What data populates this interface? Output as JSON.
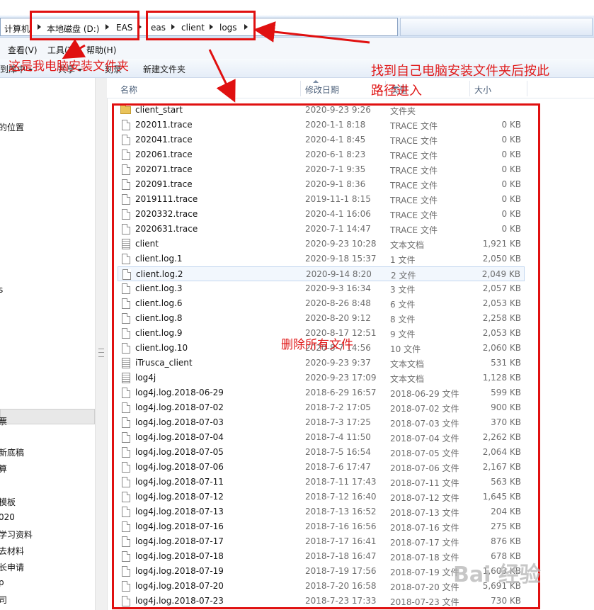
{
  "address": {
    "crumbs": [
      "计算机",
      "本地磁盘 (D:)",
      "EAS",
      "eas",
      "client",
      "logs"
    ]
  },
  "menu": [
    "查看(V)",
    "工具(T)",
    "帮助(H)"
  ],
  "toolbar": {
    "include": "到库中",
    "share": "共享",
    "burn": "刻录",
    "new_folder": "新建文件夹"
  },
  "nav": {
    "items": [
      "的位置",
      "s",
      "票",
      "新底稿",
      "算",
      "模板",
      "020",
      "学习资料",
      "去材料",
      "长申请",
      "p",
      "司"
    ]
  },
  "columns": {
    "name": "名称",
    "date": "修改日期",
    "type": "类型",
    "size": "大小"
  },
  "files": [
    {
      "name": "client_start",
      "date": "2020-9-23 9:26",
      "type": "文件夹",
      "size": "",
      "icon": "folder-icon"
    },
    {
      "name": "202011.trace",
      "date": "2020-1-1 8:18",
      "type": "TRACE 文件",
      "size": "0 KB",
      "icon": "file-icon"
    },
    {
      "name": "202041.trace",
      "date": "2020-4-1 8:45",
      "type": "TRACE 文件",
      "size": "0 KB",
      "icon": "file-icon"
    },
    {
      "name": "202061.trace",
      "date": "2020-6-1 8:23",
      "type": "TRACE 文件",
      "size": "0 KB",
      "icon": "file-icon"
    },
    {
      "name": "202071.trace",
      "date": "2020-7-1 9:35",
      "type": "TRACE 文件",
      "size": "0 KB",
      "icon": "file-icon"
    },
    {
      "name": "202091.trace",
      "date": "2020-9-1 8:36",
      "type": "TRACE 文件",
      "size": "0 KB",
      "icon": "file-icon"
    },
    {
      "name": "2019111.trace",
      "date": "2019-11-1 8:15",
      "type": "TRACE 文件",
      "size": "0 KB",
      "icon": "file-icon"
    },
    {
      "name": "2020332.trace",
      "date": "2020-4-1 16:06",
      "type": "TRACE 文件",
      "size": "0 KB",
      "icon": "file-icon"
    },
    {
      "name": "2020631.trace",
      "date": "2020-7-1 14:47",
      "type": "TRACE 文件",
      "size": "0 KB",
      "icon": "file-icon"
    },
    {
      "name": "client",
      "date": "2020-9-23 10:28",
      "type": "文本文档",
      "size": "1,921 KB",
      "icon": "text-file-icon"
    },
    {
      "name": "client.log.1",
      "date": "2020-9-18 15:37",
      "type": "1 文件",
      "size": "2,050 KB",
      "icon": "file-icon"
    },
    {
      "name": "client.log.2",
      "date": "2020-9-14 8:20",
      "type": "2 文件",
      "size": "2,049 KB",
      "icon": "file-icon",
      "selected": true
    },
    {
      "name": "client.log.3",
      "date": "2020-9-3 16:34",
      "type": "3 文件",
      "size": "2,057 KB",
      "icon": "file-icon"
    },
    {
      "name": "client.log.6",
      "date": "2020-8-26 8:48",
      "type": "6 文件",
      "size": "2,053 KB",
      "icon": "file-icon"
    },
    {
      "name": "client.log.8",
      "date": "2020-8-20 9:12",
      "type": "8 文件",
      "size": "2,258 KB",
      "icon": "file-icon"
    },
    {
      "name": "client.log.9",
      "date": "2020-8-17 12:51",
      "type": "9 文件",
      "size": "2,053 KB",
      "icon": "file-icon"
    },
    {
      "name": "client.log.10",
      "date": "2020-8-7 14:56",
      "type": "10 文件",
      "size": "2,060 KB",
      "icon": "file-icon"
    },
    {
      "name": "iTrusca_client",
      "date": "2020-9-23 9:37",
      "type": "文本文档",
      "size": "531 KB",
      "icon": "text-file-icon"
    },
    {
      "name": "log4j",
      "date": "2020-9-23 17:09",
      "type": "文本文档",
      "size": "1,128 KB",
      "icon": "text-file-icon"
    },
    {
      "name": "log4j.log.2018-06-29",
      "date": "2018-6-29 16:57",
      "type": "2018-06-29 文件",
      "size": "599 KB",
      "icon": "file-icon"
    },
    {
      "name": "log4j.log.2018-07-02",
      "date": "2018-7-2 17:05",
      "type": "2018-07-02 文件",
      "size": "900 KB",
      "icon": "file-icon"
    },
    {
      "name": "log4j.log.2018-07-03",
      "date": "2018-7-3 17:25",
      "type": "2018-07-03 文件",
      "size": "370 KB",
      "icon": "file-icon"
    },
    {
      "name": "log4j.log.2018-07-04",
      "date": "2018-7-4 11:50",
      "type": "2018-07-04 文件",
      "size": "2,262 KB",
      "icon": "file-icon"
    },
    {
      "name": "log4j.log.2018-07-05",
      "date": "2018-7-5 16:54",
      "type": "2018-07-05 文件",
      "size": "2,064 KB",
      "icon": "file-icon"
    },
    {
      "name": "log4j.log.2018-07-06",
      "date": "2018-7-6 17:47",
      "type": "2018-07-06 文件",
      "size": "2,167 KB",
      "icon": "file-icon"
    },
    {
      "name": "log4j.log.2018-07-11",
      "date": "2018-7-11 17:43",
      "type": "2018-07-11 文件",
      "size": "563 KB",
      "icon": "file-icon"
    },
    {
      "name": "log4j.log.2018-07-12",
      "date": "2018-7-12 16:40",
      "type": "2018-07-12 文件",
      "size": "1,645 KB",
      "icon": "file-icon"
    },
    {
      "name": "log4j.log.2018-07-13",
      "date": "2018-7-13 16:52",
      "type": "2018-07-13 文件",
      "size": "204 KB",
      "icon": "file-icon"
    },
    {
      "name": "log4j.log.2018-07-16",
      "date": "2018-7-16 16:56",
      "type": "2018-07-16 文件",
      "size": "275 KB",
      "icon": "file-icon"
    },
    {
      "name": "log4j.log.2018-07-17",
      "date": "2018-7-17 16:41",
      "type": "2018-07-17 文件",
      "size": "876 KB",
      "icon": "file-icon"
    },
    {
      "name": "log4j.log.2018-07-18",
      "date": "2018-7-18 16:47",
      "type": "2018-07-18 文件",
      "size": "678 KB",
      "icon": "file-icon"
    },
    {
      "name": "log4j.log.2018-07-19",
      "date": "2018-7-19 17:56",
      "type": "2018-07-19 文件",
      "size": "1,603 KB",
      "icon": "file-icon"
    },
    {
      "name": "log4j.log.2018-07-20",
      "date": "2018-7-20 16:58",
      "type": "2018-07-20 文件",
      "size": "5,691 KB",
      "icon": "file-icon"
    },
    {
      "name": "log4j.log.2018-07-23",
      "date": "2018-7-23 17:33",
      "type": "2018-07-23 文件",
      "size": "730 KB",
      "icon": "file-icon"
    }
  ],
  "annotations": {
    "folder_note": "这是我电脑安装文件夹",
    "path_note_1": "找到自己电脑安装文件夹后按此",
    "path_note_2": "路径进入",
    "delete_note": "删除所有文件",
    "color": "#e01a1a"
  },
  "watermark": "Bai 经验"
}
